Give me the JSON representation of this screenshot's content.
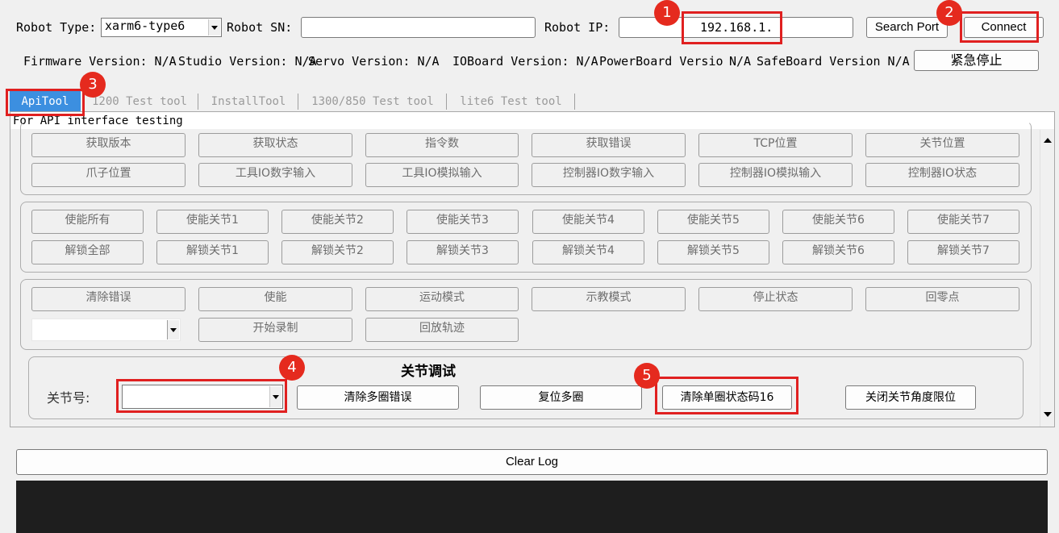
{
  "header": {
    "robot_type_label": "Robot Type:",
    "robot_type_value": "xarm6-type6",
    "robot_sn_label": "Robot SN:",
    "robot_ip_label": "Robot IP:",
    "robot_ip_value": "192.168.1.",
    "search_port_label": "Search Port",
    "connect_label": "Connect"
  },
  "firmware": {
    "firmware": "Firmware Version: N/A",
    "studio": "Studio Version: N/A",
    "servo": "Servo Version: N/A",
    "ioboard": "IOBoard Version: N/A",
    "powerboard": "PowerBoard Versio",
    "powerboard_value": "N/A",
    "safeboard": "SafeBoard Version N/A",
    "estop_label": "紧急停止"
  },
  "tabs": [
    "ApiTool",
    "1200 Test tool",
    "InstallTool",
    "1300/850 Test tool",
    "lite6 Test tool"
  ],
  "tab_description": "For API interface testing",
  "group1": {
    "row1": [
      "获取版本",
      "获取状态",
      "指令数",
      "获取错误",
      "TCP位置",
      "关节位置"
    ],
    "row2": [
      "爪子位置",
      "工具IO数字输入",
      "工具IO模拟输入",
      "控制器IO数字输入",
      "控制器IO模拟输入",
      "控制器IO状态"
    ]
  },
  "group2": {
    "row1": [
      "使能所有",
      "使能关节1",
      "使能关节2",
      "使能关节3",
      "使能关节4",
      "使能关节5",
      "使能关节6",
      "使能关节7"
    ],
    "row2": [
      "解锁全部",
      "解锁关节1",
      "解锁关节2",
      "解锁关节3",
      "解锁关节4",
      "解锁关节5",
      "解锁关节6",
      "解锁关节7"
    ]
  },
  "group3": {
    "row1": [
      "清除错误",
      "使能",
      "运动模式",
      "示教模式",
      "停止状态",
      "回零点"
    ],
    "row2": [
      "开始录制",
      "回放轨迹"
    ]
  },
  "joint_debug": {
    "title": "关节调试",
    "joint_label": "关节号:",
    "buttons": [
      "清除多圈错误",
      "复位多圈",
      "清除单圈状态码16",
      "关闭关节角度限位"
    ]
  },
  "log": {
    "clear_label": "Clear Log"
  },
  "badges": [
    "1",
    "2",
    "3",
    "4",
    "5"
  ],
  "colors": {
    "highlight": "#e02020",
    "badge": "#e52a1e",
    "active_tab": "#3c8fe0",
    "log_background": "#1e1e1e"
  }
}
